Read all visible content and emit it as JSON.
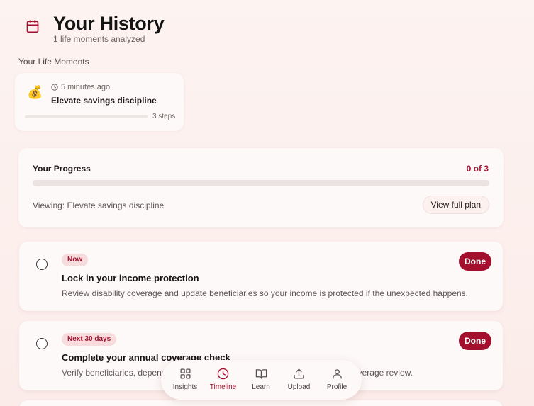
{
  "header": {
    "icon": "calendar-icon",
    "title": "Your History",
    "subtitle": "1 life moments analyzed"
  },
  "moments_section": {
    "label": "Your Life Moments",
    "items": [
      {
        "emoji": "💰",
        "time": "5 minutes ago",
        "title": "Elevate savings discipline",
        "steps": "3 steps",
        "progress_fraction": 0
      }
    ]
  },
  "progress": {
    "label": "Your Progress",
    "count": "0 of 3",
    "fraction": 0,
    "viewing": "Viewing: Elevate savings discipline",
    "view_plan_label": "View full plan"
  },
  "tasks": [
    {
      "badge": "Now",
      "title": "Lock in your income protection",
      "description": "Review disability coverage and update beneficiaries so your income is protected if the unexpected happens.",
      "done_label": "Done",
      "checked": false
    },
    {
      "badge": "Next 30 days",
      "title": "Complete your annual coverage check",
      "description": "Verify beneficiaries, dependents, and coverage amounts during your annual coverage review.",
      "done_label": "Done",
      "checked": false
    }
  ],
  "nav": {
    "items": [
      {
        "label": "Insights",
        "icon": "grid-icon",
        "active": false
      },
      {
        "label": "Timeline",
        "icon": "clock-icon",
        "active": true
      },
      {
        "label": "Learn",
        "icon": "book-icon",
        "active": false
      },
      {
        "label": "Upload",
        "icon": "upload-icon",
        "active": false
      },
      {
        "label": "Profile",
        "icon": "user-icon",
        "active": false
      }
    ]
  },
  "colors": {
    "accent": "#a3102e",
    "badge_bg": "#f7dcdd",
    "background": "#fdf3f1"
  }
}
